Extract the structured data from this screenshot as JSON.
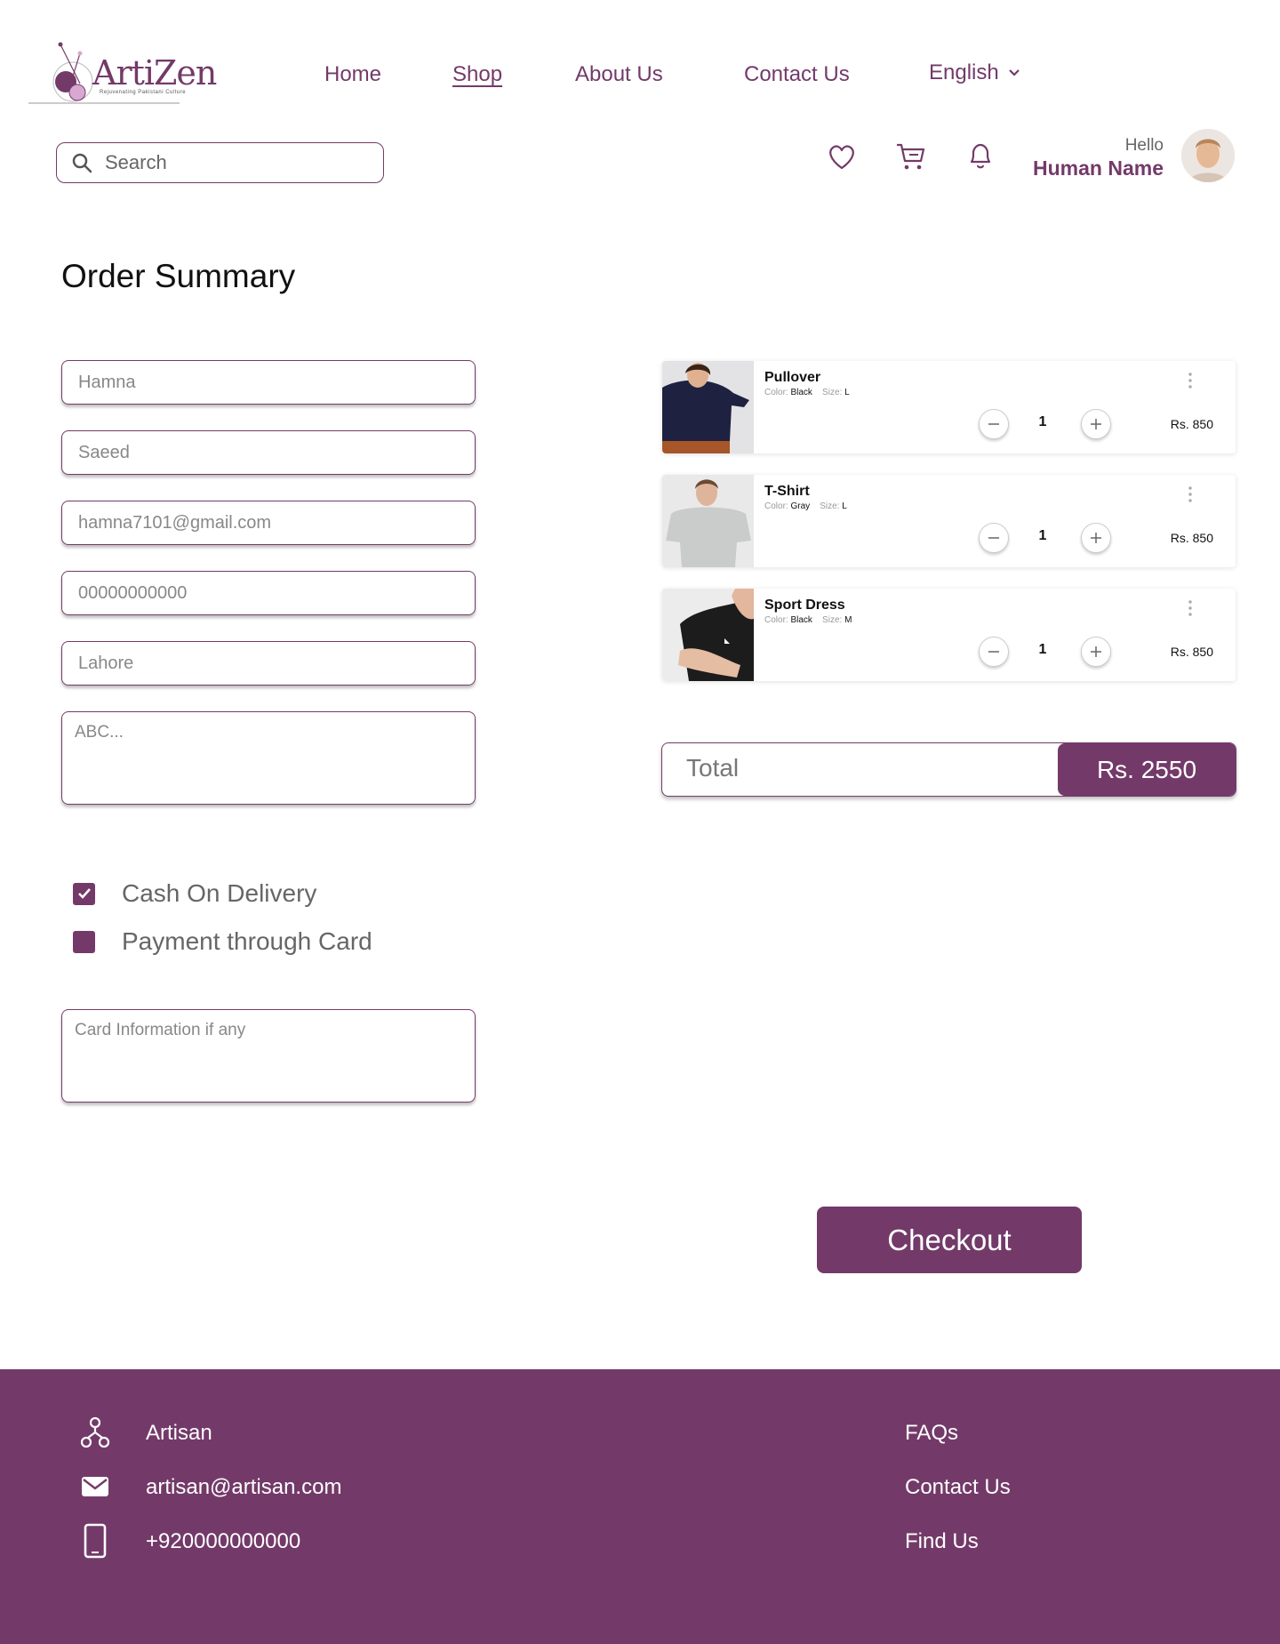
{
  "brand": {
    "name": "ArtiZen",
    "tagline": "Rejuvenating Pakistani Culture"
  },
  "nav": {
    "items": [
      {
        "label": "Home"
      },
      {
        "label": "Shop"
      },
      {
        "label": "About Us"
      },
      {
        "label": "Contact Us"
      }
    ],
    "active": "Shop",
    "language": "English"
  },
  "search": {
    "placeholder": "Search"
  },
  "user": {
    "greeting": "Hello",
    "name": "Human Name"
  },
  "order": {
    "title": "Order Summary",
    "fields": {
      "first_name": "Hamna",
      "last_name": "Saeed",
      "email": "hamna7101@gmail.com",
      "phone": "00000000000",
      "city": "Lahore",
      "address": "ABC..."
    },
    "payment": {
      "cod_label": "Cash On Delivery",
      "cod_checked": true,
      "card_label": "Payment through Card",
      "card_checked": false
    },
    "card_info_placeholder": "Card Information if any"
  },
  "cart": {
    "color_label": "Color:",
    "size_label": "Size:",
    "items": [
      {
        "name": "Pullover",
        "color": "Black",
        "size": "L",
        "qty": "1",
        "price": "Rs. 850"
      },
      {
        "name": "T-Shirt",
        "color": "Gray",
        "size": "L",
        "qty": "1",
        "price": "Rs. 850"
      },
      {
        "name": "Sport Dress",
        "color": "Black",
        "size": "M",
        "qty": "1",
        "price": "Rs. 850"
      }
    ],
    "total_label": "Total",
    "total_value": "Rs. 2550"
  },
  "checkout_label": "Checkout",
  "footer": {
    "company": "Artisan",
    "email": "artisan@artisan.com",
    "phone": "+920000000000",
    "links": [
      {
        "label": "FAQs"
      },
      {
        "label": "Contact Us"
      },
      {
        "label": "Find Us"
      }
    ]
  },
  "colors": {
    "accent": "#733a69",
    "footer_bg": "#733a69"
  }
}
